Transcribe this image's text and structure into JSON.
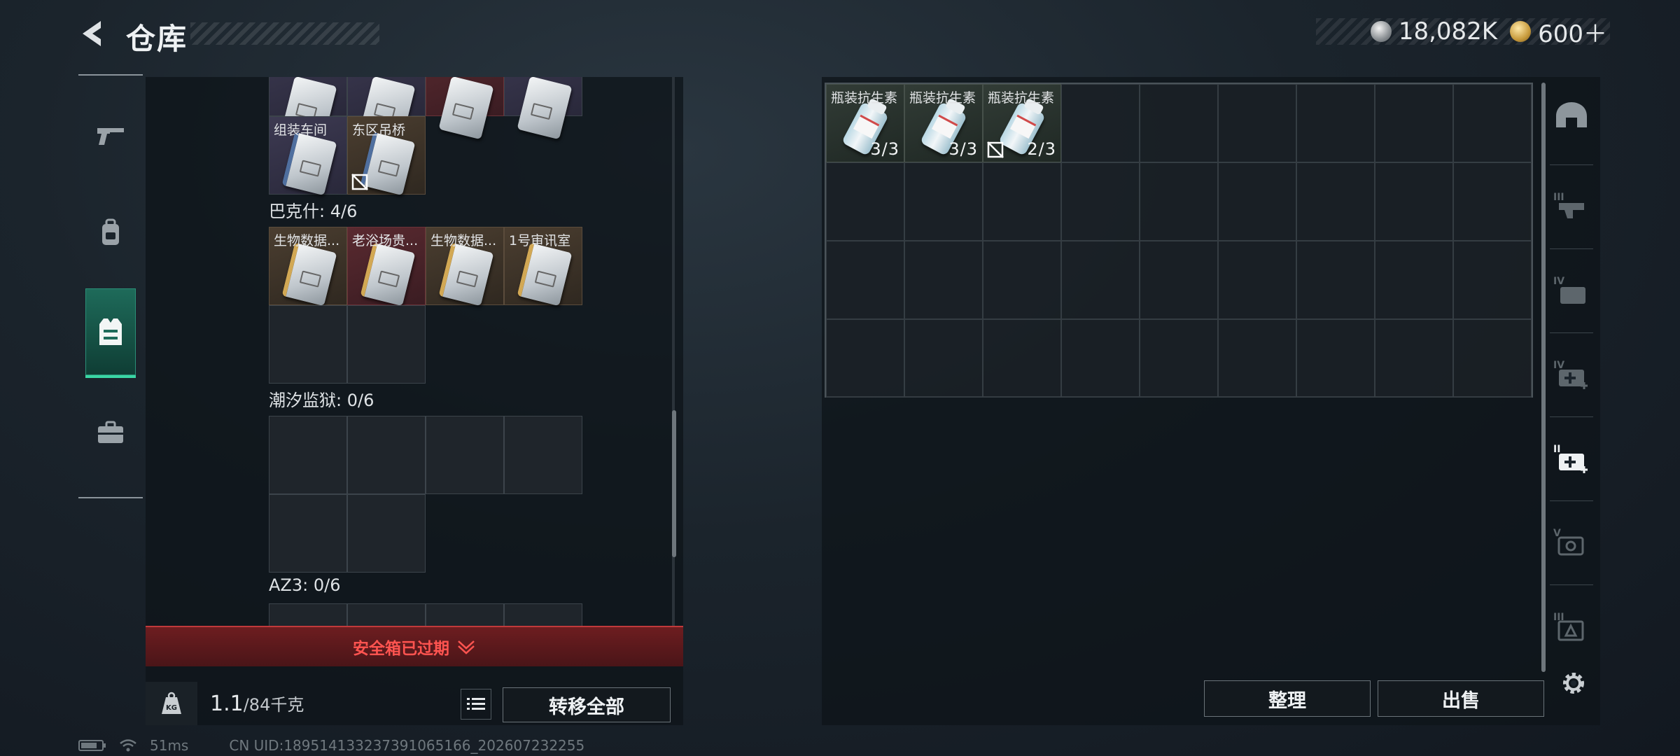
{
  "header": {
    "title": "仓库",
    "currencies": [
      {
        "icon": "silver-coin-icon",
        "value": "18,082K"
      },
      {
        "icon": "gold-coin-icon",
        "value": "600＋"
      }
    ]
  },
  "left_rail": {
    "items": [
      {
        "icon": "gun-icon",
        "active": false
      },
      {
        "icon": "backpack-icon",
        "active": false
      },
      {
        "icon": "vest-icon",
        "active": true
      },
      {
        "icon": "briefcase-icon",
        "active": false
      }
    ]
  },
  "left_panel": {
    "partial_top_row": [
      "",
      "",
      "",
      ""
    ],
    "group_a": {
      "cells": [
        {
          "label": "组装车间"
        },
        {
          "label": "东区吊桥",
          "locked": true
        }
      ]
    },
    "section_bakeshi": {
      "title": "巴克什: 4/6",
      "cells": [
        {
          "label": "生物数据..."
        },
        {
          "label": "老浴场贵..."
        },
        {
          "label": "生物数据..."
        },
        {
          "label": "1号审讯室"
        }
      ]
    },
    "section_chaoxi": {
      "title": "潮汐监狱: 0/6"
    },
    "section_az3": {
      "title": "AZ3: 0/6"
    },
    "expired_text": "安全箱已过期",
    "weight_current": "1.1",
    "weight_total": "/84千克",
    "transfer_all_label": "转移全部"
  },
  "right_panel": {
    "items": [
      {
        "label": "瓶装抗生素",
        "count": "3/3",
        "locked": false
      },
      {
        "label": "瓶装抗生素",
        "count": "3/3",
        "locked": false
      },
      {
        "label": "瓶装抗生素",
        "count": "2/3",
        "locked": true
      }
    ],
    "sort_label": "整理",
    "sell_label": "出售"
  },
  "right_rail": {
    "items": [
      {
        "icon": "helmet-icon"
      },
      {
        "icon": "armor-iii-icon"
      },
      {
        "icon": "ammo-iv-icon"
      },
      {
        "icon": "medkit-iv-icon"
      },
      {
        "icon": "medkit-ii-icon"
      },
      {
        "icon": "gear-v-icon"
      },
      {
        "icon": "box-iii-icon"
      }
    ]
  },
  "status": {
    "ping": "51ms",
    "uid": "CN UID:18951413323739106516​6_202607232255"
  },
  "colors": {
    "accent_green": "#3ad6a4",
    "expired_red": "#ff5450",
    "panel_bg": "#0e141a"
  }
}
